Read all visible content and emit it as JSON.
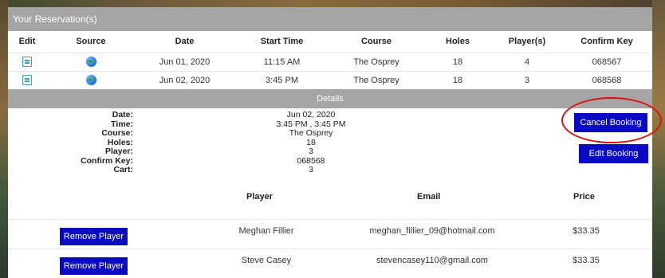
{
  "panel": {
    "title": "Your Reservation(s)"
  },
  "table": {
    "headers": [
      "Edit",
      "Source",
      "Date",
      "Start Time",
      "Course",
      "Holes",
      "Player(s)",
      "Confirm Key"
    ],
    "rows": [
      {
        "edit_icon": "edit-icon",
        "source_icon": "globe-icon",
        "date": "Jun 01, 2020",
        "start_time": "11:15 AM",
        "course": "The Osprey",
        "holes": "18",
        "players": "4",
        "confirm_key": "068567"
      },
      {
        "edit_icon": "edit-icon",
        "source_icon": "globe-icon",
        "date": "Jun 02, 2020",
        "start_time": "3:45 PM",
        "course": "The Osprey",
        "holes": "18",
        "players": "3",
        "confirm_key": "068568"
      }
    ]
  },
  "details": {
    "title": "Details",
    "labels": [
      "Date:",
      "Time:",
      "Course:",
      "Holes:",
      "Player:",
      "Confirm Key:",
      "Cart:"
    ],
    "values": [
      "Jun 02, 2020",
      "3:45 PM , 3:45 PM",
      "The Osprey",
      "18",
      "3",
      "068568",
      "3"
    ],
    "cancel_label": "Cancel Booking",
    "edit_label": "Edit Booking",
    "highlight_color": "#e01010"
  },
  "players": {
    "headers": {
      "player": "Player",
      "email": "Email",
      "price": "Price"
    },
    "rows": [
      {
        "remove_label": "Remove Player",
        "name": "Meghan Fillier",
        "email": "meghan_fillier_09@hotmail.com",
        "price": "$33.35"
      },
      {
        "remove_label": "Remove Player",
        "name": "Steve Casey",
        "email": "stevencasey110@gmail.com",
        "price": "$33.35"
      }
    ]
  },
  "colors": {
    "header_bg": "#a5a5a5",
    "button_bg": "#0a0ac4"
  }
}
